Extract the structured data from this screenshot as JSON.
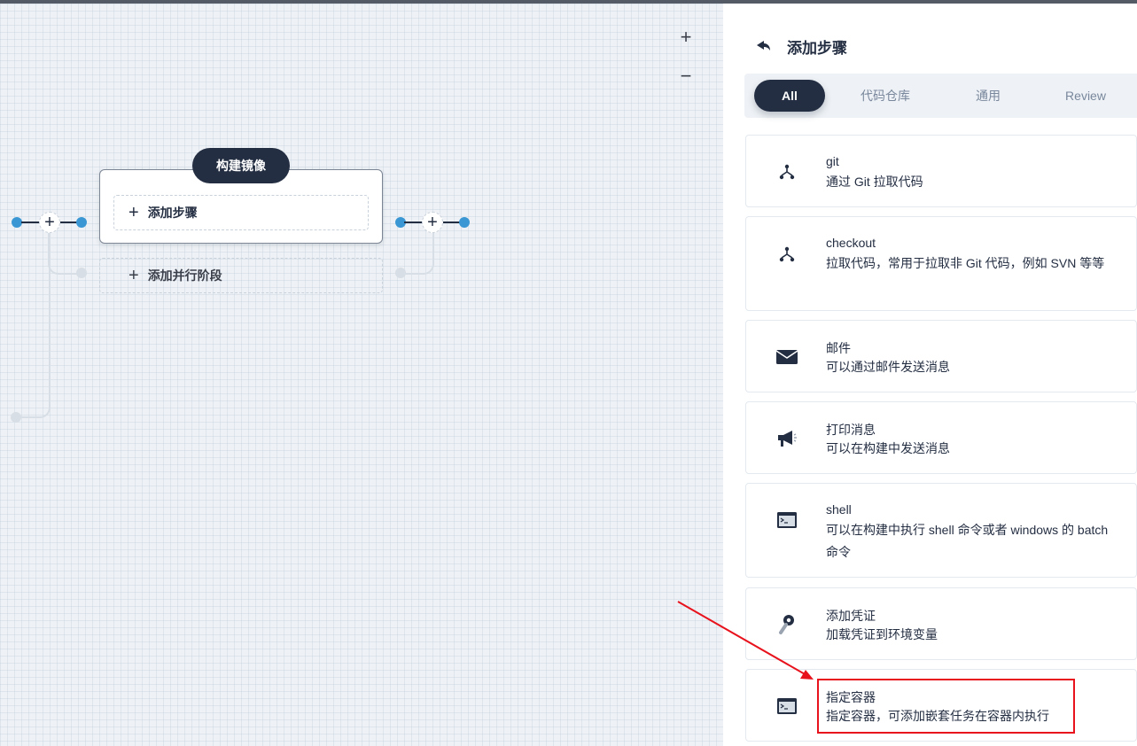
{
  "canvas": {
    "zoom_in_label": "+",
    "zoom_out_label": "−",
    "stage": {
      "title": "构建镜像",
      "add_step_label": "添加步骤",
      "add_parallel_label": "添加并行阶段"
    },
    "node_plus_label": "+"
  },
  "panel": {
    "title": "添加步骤",
    "tabs": [
      {
        "label": "All",
        "active": true
      },
      {
        "label": "代码仓库",
        "active": false
      },
      {
        "label": "通用",
        "active": false
      },
      {
        "label": "Review",
        "active": false
      }
    ],
    "steps": [
      {
        "icon": "branch-icon",
        "name": "git",
        "desc": "通过 Git 拉取代码"
      },
      {
        "icon": "branch-icon",
        "name": "checkout",
        "desc": "拉取代码，常用于拉取非 Git 代码，例如 SVN 等等"
      },
      {
        "icon": "mail-icon",
        "name": "邮件",
        "desc": "可以通过邮件发送消息"
      },
      {
        "icon": "megaphone-icon",
        "name": "打印消息",
        "desc": "可以在构建中发送消息"
      },
      {
        "icon": "terminal-icon",
        "name": "shell",
        "desc": "可以在构建中执行 shell 命令或者 windows 的 batch 命令"
      },
      {
        "icon": "key-icon",
        "name": "添加凭证",
        "desc": "加载凭证到环境变量"
      },
      {
        "icon": "terminal-icon",
        "name": "指定容器",
        "desc": "指定容器，可添加嵌套任务在容器内执行"
      }
    ]
  },
  "annotation": {
    "color": "#e8121c"
  },
  "colors": {
    "primary": "#242e42",
    "accent": "#3a97d4",
    "canvas_bg": "#eef2f6"
  }
}
